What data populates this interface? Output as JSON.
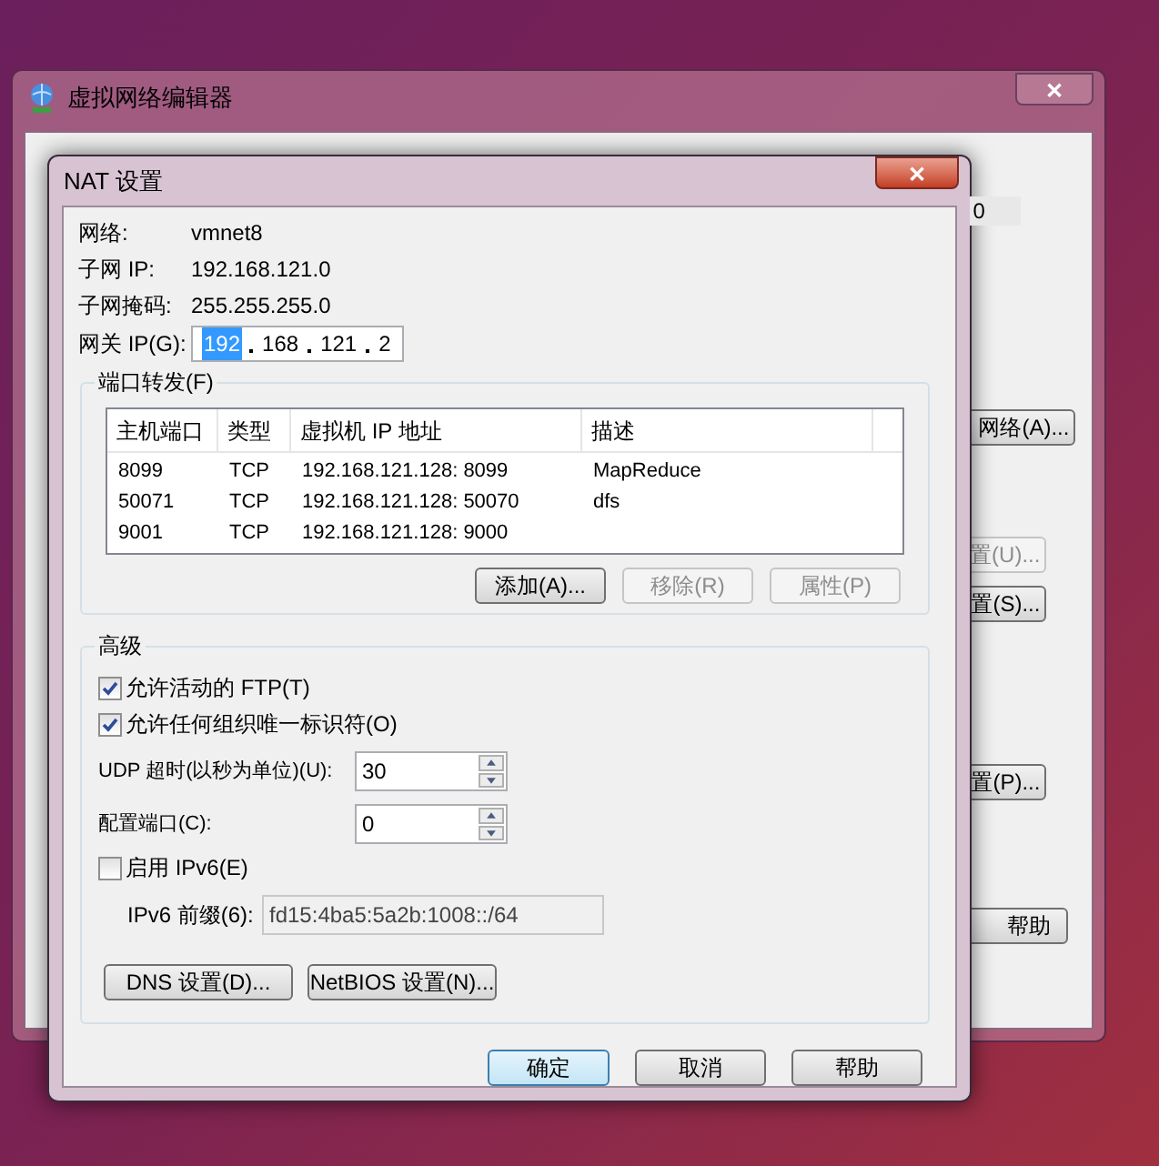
{
  "background_window": {
    "title": "虚拟网络编辑器",
    "close": "✕",
    "cell_text": "0",
    "buttons": [
      {
        "label": "网络(A)...",
        "disabled": false
      },
      {
        "label": "置(U)...",
        "disabled": true
      },
      {
        "label": "置(S)...",
        "disabled": false
      },
      {
        "label": "置(P)...",
        "disabled": false
      }
    ],
    "help_button": "帮助"
  },
  "dialog": {
    "title": "NAT 设置",
    "close": "✕",
    "info": [
      {
        "label": "网络:",
        "value": "vmnet8"
      },
      {
        "label": "子网 IP:",
        "value": "192.168.121.0"
      },
      {
        "label": "子网掩码:",
        "value": "255.255.255.0"
      }
    ],
    "gateway": {
      "label": "网关 IP(G):",
      "octets": [
        {
          "text": "192",
          "selected": true
        },
        {
          "text": "168",
          "selected": false
        },
        {
          "text": "121",
          "selected": false
        },
        {
          "text": "2",
          "selected": false
        }
      ]
    },
    "port_forwarding": {
      "title": "端口转发(F)",
      "columns": [
        "主机端口",
        "类型",
        "虚拟机 IP 地址",
        "描述"
      ],
      "rows": [
        [
          "8099",
          "TCP",
          "192.168.121.128: 8099",
          "MapReduce"
        ],
        [
          "50071",
          "TCP",
          "192.168.121.128: 50070",
          "dfs"
        ],
        [
          "9001",
          "TCP",
          "192.168.121.128: 9000",
          ""
        ]
      ],
      "buttons": [
        {
          "label": "添加(A)...",
          "disabled": false
        },
        {
          "label": "移除(R)",
          "disabled": true
        },
        {
          "label": "属性(P)",
          "disabled": true
        }
      ]
    },
    "advanced": {
      "title": "高级",
      "checkboxes": [
        {
          "label": "允许活动的 FTP(T)",
          "checked": true
        },
        {
          "label": "允许任何组织唯一标识符(O)",
          "checked": true
        }
      ],
      "spinners": [
        {
          "label": "UDP 超时(以秒为单位)(U):",
          "value": "30"
        },
        {
          "label": "配置端口(C):",
          "value": "0"
        }
      ],
      "ipv6": {
        "label": "启用 IPv6(E)",
        "checked": false
      },
      "prefix": {
        "label": "IPv6 前缀(6):",
        "value": "fd15:4ba5:5a2b:1008::/64",
        "disabled": true
      },
      "buttons": [
        "DNS 设置(D)...",
        "NetBIOS 设置(N)..."
      ]
    },
    "footer_buttons": [
      {
        "label": "确定",
        "default": true
      },
      {
        "label": "取消",
        "default": false
      },
      {
        "label": "帮助",
        "default": false
      }
    ]
  }
}
